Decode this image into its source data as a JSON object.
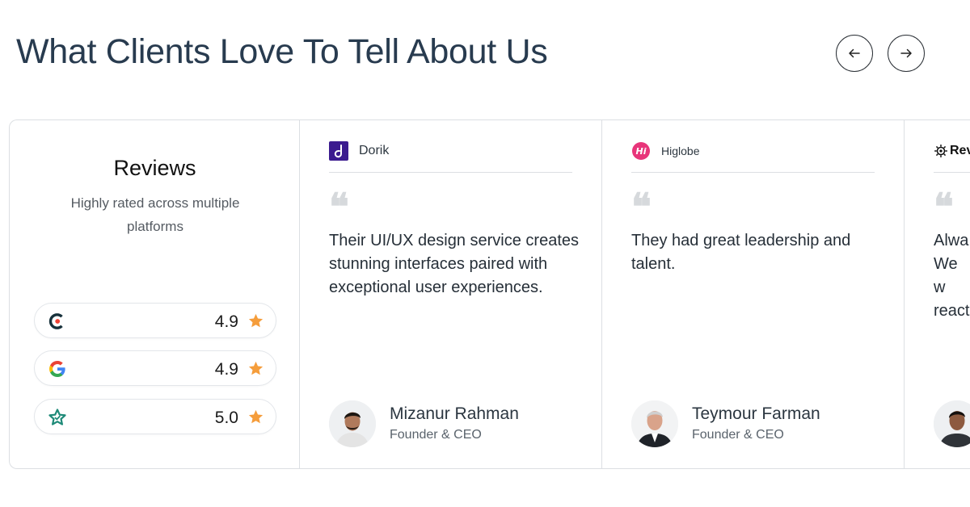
{
  "page": {
    "title": "What Clients Love To Tell About Us",
    "prev_label": "←",
    "next_label": "→"
  },
  "summary": {
    "title": "Reviews",
    "subtitle": "Highly rated across multiple platforms",
    "ratings": [
      {
        "platform_icon": "clutch-logo-icon",
        "score": "4.9",
        "star_color": "#f59d3b"
      },
      {
        "platform_icon": "google-logo-icon",
        "score": "4.9",
        "star_color": "#f59d3b"
      },
      {
        "platform_icon": "star-badge-logo-icon",
        "score": "5.0",
        "star_color": "#f59d3b"
      }
    ]
  },
  "testimonials": [
    {
      "brand": "Dorik",
      "brand_icon": "dorik-logo-icon",
      "quote_mark": "❝",
      "quote": "Their UI/UX design service creates stunning interfaces paired with exceptional user experiences.",
      "name": "Mizanur Rahman",
      "role": "Founder & CEO"
    },
    {
      "brand": "Higlobe",
      "brand_icon": "higlobe-logo-icon",
      "quote_mark": "❝",
      "quote": "They had great leadership and talent.",
      "name": "Teymour Farman",
      "role": "Founder & CEO"
    },
    {
      "brand": "Rev",
      "brand_icon": "gear-logo-icon",
      "quote_mark": "❝",
      "quote": "Alwa We w react",
      "name": "",
      "role": ""
    }
  ],
  "colors": {
    "accent_star": "#f59d3b",
    "dorik": "#3b1b8f",
    "higlobe": "#e8357a",
    "clutch_dark": "#17313b",
    "clutch_red": "#ef4335"
  }
}
